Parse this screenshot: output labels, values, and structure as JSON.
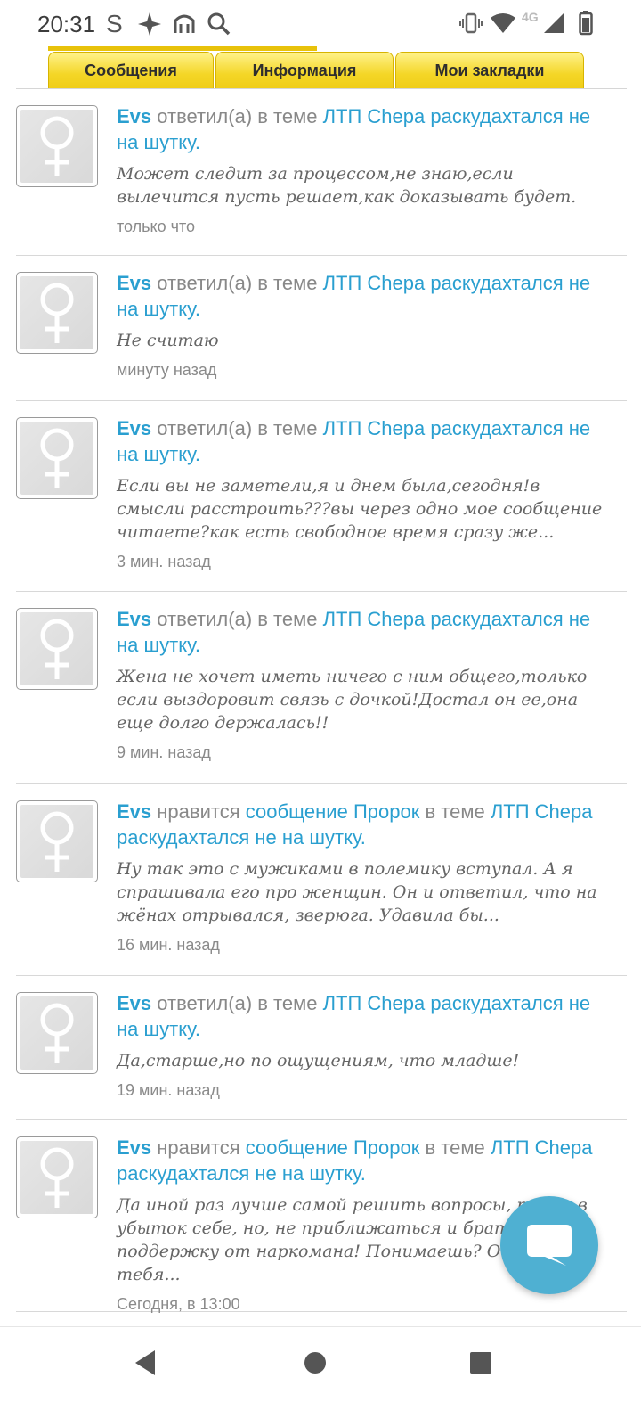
{
  "status_bar": {
    "time": "20:31",
    "left_icons": [
      "s-icon",
      "sparkle-icon",
      "transit-icon",
      "search-icon"
    ],
    "network": "4G",
    "right_icons": [
      "vibrate-icon",
      "wifi-icon",
      "signal-icon",
      "battery-icon"
    ]
  },
  "tabs": [
    {
      "label": "Сообщения"
    },
    {
      "label": "Информация"
    },
    {
      "label": "Мои закладки"
    }
  ],
  "feed": [
    {
      "user": "Evs",
      "action": "ответил(а) в теме",
      "liked_message": "",
      "in_topic": "",
      "topic": "ЛТП Chepa раскудахтался не на шутку",
      "period": ".",
      "snippet": "Может следит за процессом,не знаю,если вылечится пусть решает,как доказывать будет.",
      "time": "только что"
    },
    {
      "user": "Evs",
      "action": "ответил(а) в теме",
      "liked_message": "",
      "in_topic": "",
      "topic": "ЛТП Chepa раскудахтался не на шутку",
      "period": ".",
      "snippet": "Не считаю",
      "time": "минуту назад"
    },
    {
      "user": "Evs",
      "action": "ответил(а) в теме",
      "liked_message": "",
      "in_topic": "",
      "topic": "ЛТП Chepa раскудахтался не на шутку",
      "period": ".",
      "snippet": "Если вы не заметели,я и днем была,сегодня!в смысли расстроить???вы через одно мое сообщение читаете?как есть свободное время сразу же...",
      "time": "3 мин. назад"
    },
    {
      "user": "Evs",
      "action": "ответил(а) в теме",
      "liked_message": "",
      "in_topic": "",
      "topic": "ЛТП Chepa раскудахтался не на шутку",
      "period": ".",
      "snippet": "Жена не хочет иметь ничего с ним общего,только если выздоровит связь с дочкой!Достал он ее,она еще долго держалась!!",
      "time": "9 мин. назад"
    },
    {
      "user": "Evs",
      "action": "нравится",
      "liked_message": "сообщение Пророк",
      "in_topic": "в теме",
      "topic": "ЛТП Chepa раскудахтался не на шутку",
      "period": ".",
      "snippet": "Ну так это с мужиками в полемику вступал. А я спрашивала его про женщин. Он и ответил, что на жёнах отрывался, зверюга. Удавила бы...",
      "time": "16 мин. назад"
    },
    {
      "user": "Evs",
      "action": "ответил(а) в теме",
      "liked_message": "",
      "in_topic": "",
      "topic": "ЛТП Chepa раскудахтался не на шутку",
      "period": ".",
      "snippet": "Да,старше,но по ощущениям, что младше!",
      "time": "19 мин. назад"
    },
    {
      "user": "Evs",
      "action": "нравится",
      "liked_message": "сообщение Пророк",
      "in_topic": "в теме",
      "topic": "ЛТП Chepa раскудахтался не на шутку",
      "period": ".",
      "snippet": "Да иной раз лучше самой решить вопросы, пусть в убыток себе, но, не приближаться и брать поддержку от наркомана! Понимаешь? Она близко тебя...",
      "time": "Сегодня, в 13:00"
    }
  ],
  "fab": {
    "icon": "chat-bubble-icon"
  },
  "nav": {
    "icons": [
      "back-icon",
      "home-icon",
      "recents-icon"
    ]
  },
  "colors": {
    "accent": "#2a9fd0",
    "tab_yellow": "#f4d626",
    "fab": "#4fb0d2"
  }
}
